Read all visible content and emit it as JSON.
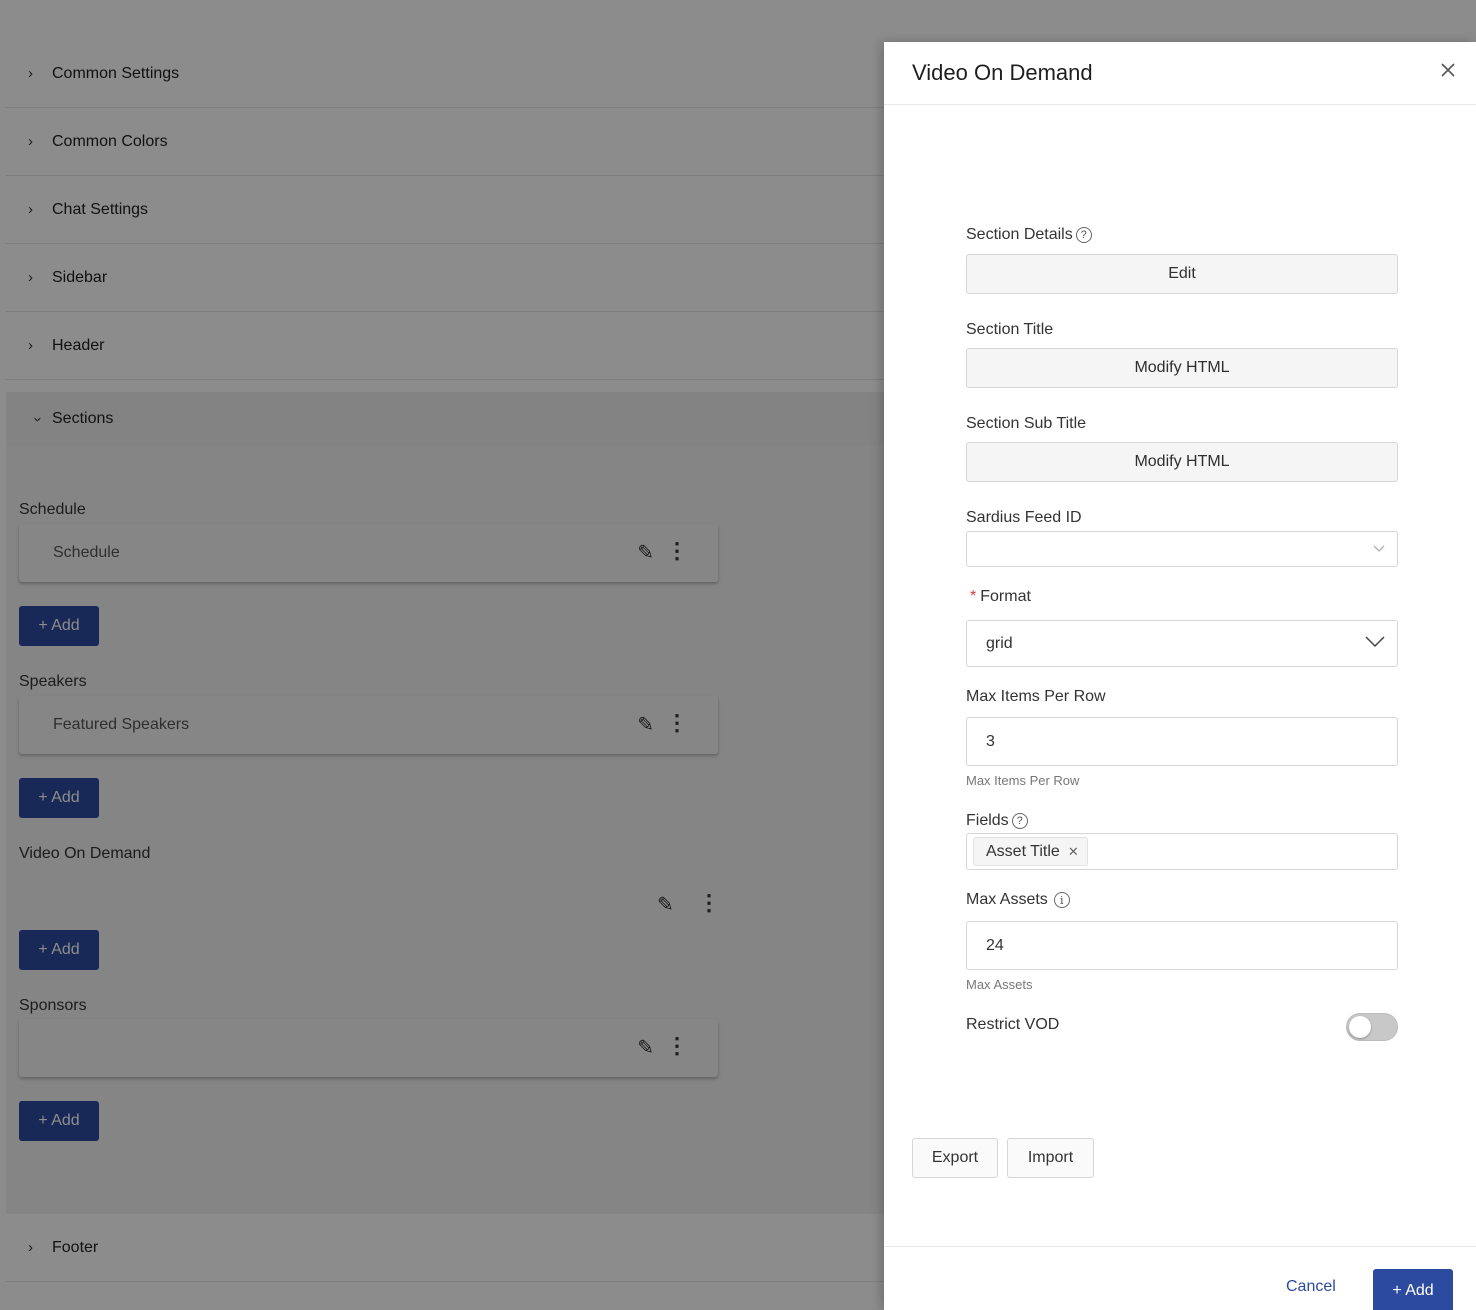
{
  "accordion": {
    "items": [
      {
        "label": "Common Settings"
      },
      {
        "label": "Common Colors"
      },
      {
        "label": "Chat Settings"
      },
      {
        "label": "Sidebar"
      },
      {
        "label": "Header"
      }
    ],
    "sections_label": "Sections",
    "footer_label": "Footer"
  },
  "sections": {
    "schedule": {
      "title": "Schedule",
      "card_label": "Schedule",
      "add_label": "+ Add"
    },
    "speakers": {
      "title": "Speakers",
      "card_label": "Featured Speakers",
      "add_label": "+ Add"
    },
    "vod": {
      "title": "Video On Demand",
      "add_label": "+ Add"
    },
    "sponsors": {
      "title": "Sponsors",
      "card_label": "",
      "add_label": "+ Add"
    }
  },
  "drawer": {
    "title": "Video On Demand",
    "section_details": {
      "label": "Section Details",
      "button": "Edit"
    },
    "section_title": {
      "label": "Section Title",
      "button": "Modify HTML"
    },
    "section_sub_title": {
      "label": "Section Sub Title",
      "button": "Modify HTML"
    },
    "sardius_feed_id": {
      "label": "Sardius Feed ID",
      "value": ""
    },
    "format": {
      "label": "Format",
      "required_mark": "*",
      "value": "grid"
    },
    "max_items_per_row": {
      "label": "Max Items Per Row",
      "value": "3",
      "hint": "Max Items Per Row"
    },
    "fields": {
      "label": "Fields",
      "tags": [
        "Asset Title"
      ]
    },
    "max_assets": {
      "label": "Max Assets",
      "value": "24",
      "hint": "Max Assets"
    },
    "restrict_vod": {
      "label": "Restrict VOD",
      "enabled": false
    },
    "export_label": "Export",
    "import_label": "Import",
    "cancel_label": "Cancel",
    "add_label": "+ Add"
  },
  "icons": {
    "chevron": "chevron-right-icon",
    "help": "question-circle-icon",
    "info": "info-circle-icon",
    "edit": "pencil-icon",
    "more": "kebab-icon",
    "close": "close-icon"
  },
  "colors": {
    "primary": "#2c4a9e",
    "required": "#e03b3b"
  }
}
